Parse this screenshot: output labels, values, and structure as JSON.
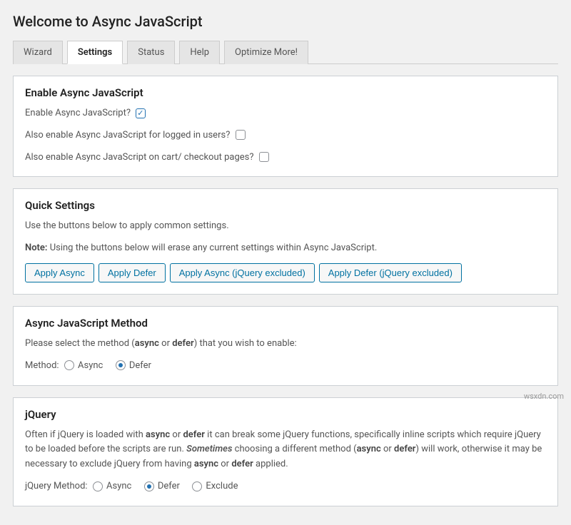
{
  "page_title": "Welcome to Async JavaScript",
  "tabs": [
    {
      "label": "Wizard",
      "active": false
    },
    {
      "label": "Settings",
      "active": true
    },
    {
      "label": "Status",
      "active": false
    },
    {
      "label": "Help",
      "active": false
    },
    {
      "label": "Optimize More!",
      "active": false
    }
  ],
  "enable_panel": {
    "heading": "Enable Async JavaScript",
    "row1_label": "Enable Async JavaScript?",
    "row1_checked": true,
    "row2_label": "Also enable Async JavaScript for logged in users?",
    "row2_checked": false,
    "row3_label": "Also enable Async JavaScript on cart/ checkout pages?",
    "row3_checked": false
  },
  "quick_panel": {
    "heading": "Quick Settings",
    "desc": "Use the buttons below to apply common settings.",
    "note_prefix": "Note:",
    "note_text": " Using the buttons below will erase any current settings within Async JavaScript.",
    "buttons": [
      "Apply Async",
      "Apply Defer",
      "Apply Async (jQuery excluded)",
      "Apply Defer (jQuery excluded)"
    ]
  },
  "method_panel": {
    "heading": "Async JavaScript Method",
    "desc_pre": "Please select the method (",
    "desc_b1": "async",
    "desc_mid": " or ",
    "desc_b2": "defer",
    "desc_post": ") that you wish to enable:",
    "method_label": "Method:",
    "options": {
      "async": "Async",
      "defer": "Defer"
    },
    "selected": "defer"
  },
  "jquery_panel": {
    "heading": "jQuery",
    "p1_a": "Often if jQuery is loaded with ",
    "p1_b1": "async",
    "p1_b": " or ",
    "p1_b2": "defer",
    "p1_c": " it can break some jQuery functions, specifically inline scripts which require jQuery to be loaded before the scripts are run. ",
    "p1_em": "Sometimes",
    "p1_d": " choosing a different method (",
    "p1_b3": "async",
    "p1_e": " or ",
    "p1_b4": "defer",
    "p1_f": ") will work, otherwise it may be necessary to exclude jQuery from having ",
    "p1_b5": "async",
    "p1_g": " or ",
    "p1_b6": "defer",
    "p1_h": " applied.",
    "method_label": "jQuery Method:",
    "options": {
      "async": "Async",
      "defer": "Defer",
      "exclude": "Exclude"
    },
    "selected": "defer"
  },
  "watermark": "wsxdn.com"
}
